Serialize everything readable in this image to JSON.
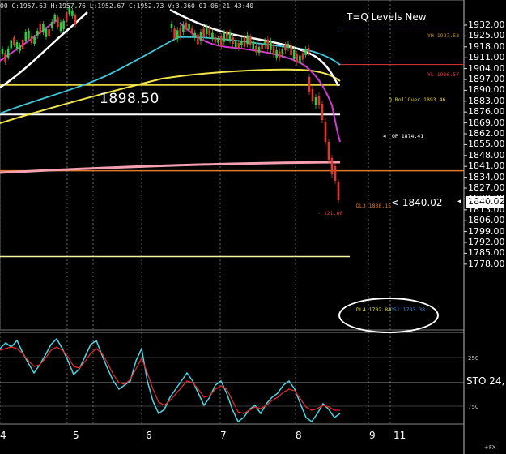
{
  "header": {
    "info": "00  C:1957.63  H:1957.76  L:1952.67  C:1952.73  V:3.360  01-06-21  43:40"
  },
  "chart_data": {
    "type": "line",
    "title": "T=Q Levels New",
    "price_axis_ticks": [
      "1932.00",
      "1925.00",
      "1918.00",
      "1911.00",
      "1904.00",
      "1897.00",
      "1890.00",
      "1883.00",
      "1876.00",
      "1869.00",
      "1862.00",
      "1855.00",
      "1848.00",
      "1841.00",
      "1834.00",
      "1827.00",
      "1820.00",
      "1813.00",
      "1806.00",
      "1799.00",
      "1792.00",
      "1785.00",
      "1778.00"
    ],
    "ylim": [
      1774,
      1938
    ],
    "x_ticks": [
      "4",
      "5",
      "6",
      "7",
      "8",
      "9",
      "11"
    ],
    "current_price": "1840.02",
    "price_callout": "< 1840.02",
    "big_level_label": "1898.50",
    "levels": [
      {
        "label": "YH 1927.53",
        "value": 1927.53,
        "color": "#c98a3a"
      },
      {
        "label": "YL 1906.57",
        "value": 1906.57,
        "color": "#e03a3a"
      },
      {
        "label": "Q RollOver 1893.46",
        "value": 1893.46,
        "color": "#e6d23a"
      },
      {
        "label": "OP 1874.41",
        "value": 1874.41,
        "color": "#ffffff"
      },
      {
        "label": "DL3 1838.15",
        "value": 1838.15,
        "color": "#e07a2a"
      },
      {
        "label": "- 121.66",
        "value": null,
        "color": "#e03a3a"
      },
      {
        "label": "DL4 1782.84",
        "value": 1782.84,
        "color": "#e6e63a"
      },
      {
        "label": "DS1 1783.38",
        "value": null,
        "color": "#4a90e2"
      }
    ],
    "stochastic": {
      "label": "STO 24,",
      "ticks": [
        "250",
        "750"
      ]
    },
    "footer_label": "+FX"
  },
  "colors": {
    "background": "#000000",
    "bull_candle": "#2ecc40",
    "bear_candle": "#e0392b",
    "ma_white": "#ffffff",
    "ma_cyan": "#3ec8d8",
    "ma_yellow": "#f0e64a",
    "ma_pink": "#f4a0b0",
    "ma_magenta": "#d23ad2",
    "stoch_fast": "#49d6e6",
    "stoch_slow": "#e02a2a",
    "grid": "#555555"
  }
}
